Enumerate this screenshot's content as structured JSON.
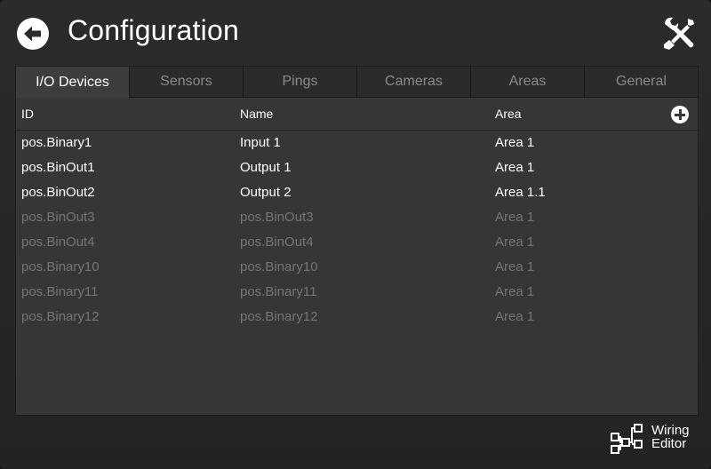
{
  "header": {
    "title": "Configuration"
  },
  "tabs": [
    {
      "label": "I/O Devices",
      "active": true
    },
    {
      "label": "Sensors",
      "active": false
    },
    {
      "label": "Pings",
      "active": false
    },
    {
      "label": "Cameras",
      "active": false
    },
    {
      "label": "Areas",
      "active": false
    },
    {
      "label": "General",
      "active": false
    }
  ],
  "table": {
    "columns": {
      "id": "ID",
      "name": "Name",
      "area": "Area"
    },
    "rows": [
      {
        "id": "pos.Binary1",
        "name": "Input 1",
        "area": "Area 1",
        "enabled": true
      },
      {
        "id": "pos.BinOut1",
        "name": "Output 1",
        "area": "Area 1",
        "enabled": true
      },
      {
        "id": "pos.BinOut2",
        "name": "Output 2",
        "area": "Area 1.1",
        "enabled": true
      },
      {
        "id": "pos.BinOut3",
        "name": "pos.BinOut3",
        "area": "Area 1",
        "enabled": false
      },
      {
        "id": "pos.BinOut4",
        "name": "pos.BinOut4",
        "area": "Area 1",
        "enabled": false
      },
      {
        "id": "pos.Binary10",
        "name": "pos.Binary10",
        "area": "Area 1",
        "enabled": false
      },
      {
        "id": "pos.Binary11",
        "name": "pos.Binary11",
        "area": "Area 1",
        "enabled": false
      },
      {
        "id": "pos.Binary12",
        "name": "pos.Binary12",
        "area": "Area 1",
        "enabled": false
      }
    ]
  },
  "footer": {
    "wiring_line1": "Wiring",
    "wiring_line2": "Editor"
  },
  "icons": {
    "back": "arrow-left-circle-icon",
    "tools": "wrench-screwdriver-icon",
    "add": "plus-circle-icon",
    "wiring": "wiring-diagram-icon"
  }
}
